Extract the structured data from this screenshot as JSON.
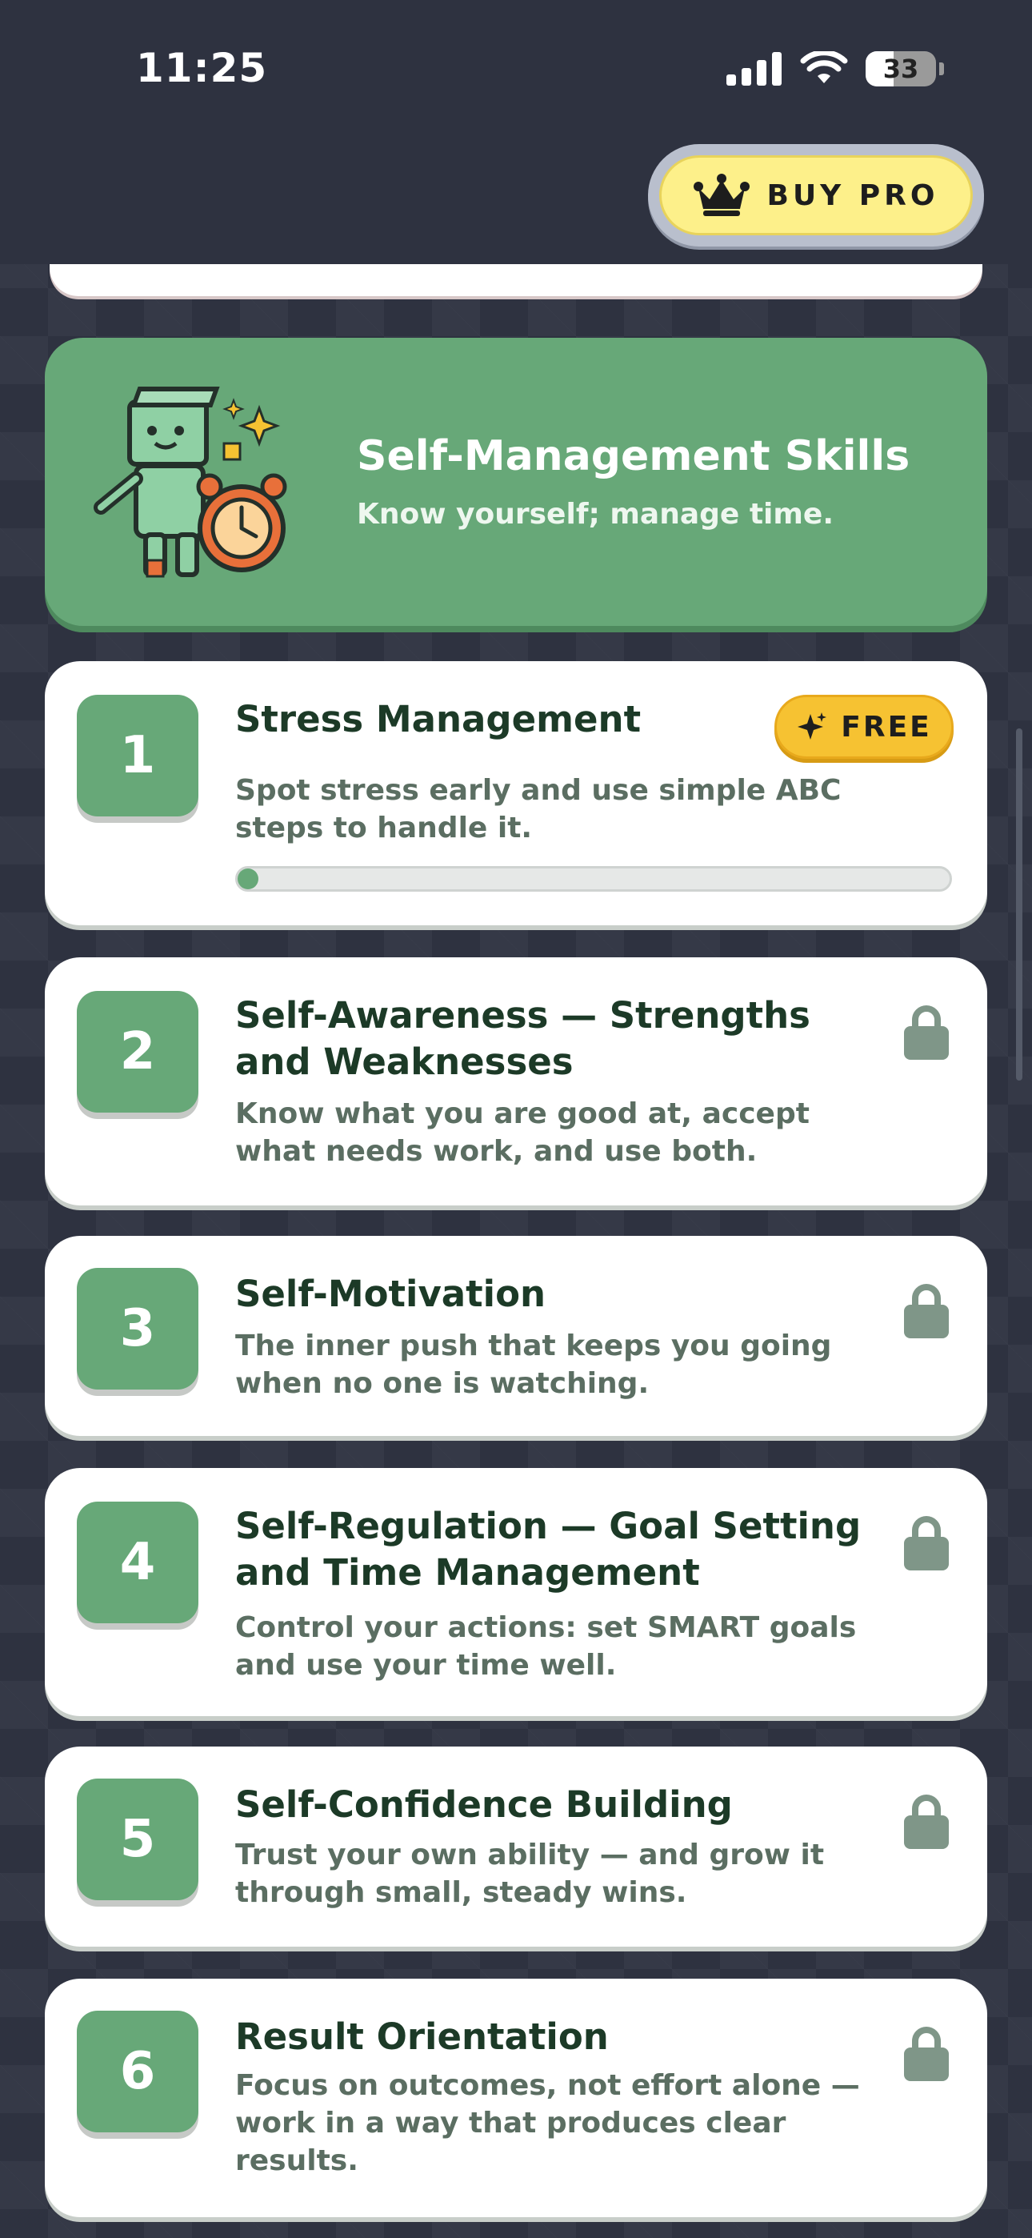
{
  "status_bar": {
    "time": "11:25",
    "battery": "33"
  },
  "header": {
    "buy_pro_label": "BUY PRO"
  },
  "section": {
    "title": "Self-Management Skills",
    "subtitle": "Know yourself; manage time."
  },
  "lessons": [
    {
      "number": "1",
      "title": "Stress Management",
      "description": "Spot stress early and use simple ABC steps to handle it.",
      "badge": "FREE",
      "progress": 0.01
    },
    {
      "number": "2",
      "title": "Self-Awareness — Strengths and Weaknesses",
      "description": "Know what you are good at, accept what needs work, and use both.",
      "locked": true
    },
    {
      "number": "3",
      "title": "Self-Motivation",
      "description": "The inner push that keeps you going when no one is watching.",
      "locked": true
    },
    {
      "number": "4",
      "title": "Self-Regulation — Goal Setting and Time Management",
      "description": "Control your actions: set SMART goals and use your time well.",
      "locked": true
    },
    {
      "number": "5",
      "title": "Self-Confidence Building",
      "description": "Trust your own ability — and grow it through small, steady wins.",
      "locked": true
    },
    {
      "number": "6",
      "title": "Result Orientation",
      "description": "Focus on outcomes, not effort alone — work in a way that produces clear results.",
      "locked": true
    }
  ],
  "colors": {
    "accent_green": "#67a878",
    "title_text": "#1c3a27",
    "free_badge": "#f6c232",
    "buy_pro": "#fdf08a",
    "background": "#2e3240"
  }
}
